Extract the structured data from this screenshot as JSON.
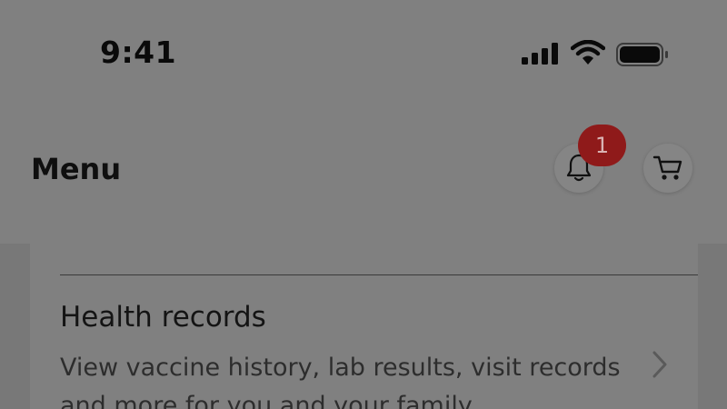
{
  "status_bar": {
    "time": "9:41",
    "signal_icon": "cellular-signal-icon",
    "wifi_icon": "wifi-icon",
    "battery_icon": "battery-icon"
  },
  "header": {
    "title": "Menu",
    "notifications": {
      "icon": "bell-icon",
      "badge_count": "1"
    },
    "cart": {
      "icon": "cart-icon"
    }
  },
  "menu_items": [
    {
      "title": "Health records",
      "description": "View vaccine history, lab results, visit records and more for you and your family",
      "icon": "chevron-right-icon"
    }
  ],
  "colors": {
    "badge_bg": "#8f1a1a",
    "overlay_bg": "#808080",
    "text_primary": "#0f0f0f"
  }
}
